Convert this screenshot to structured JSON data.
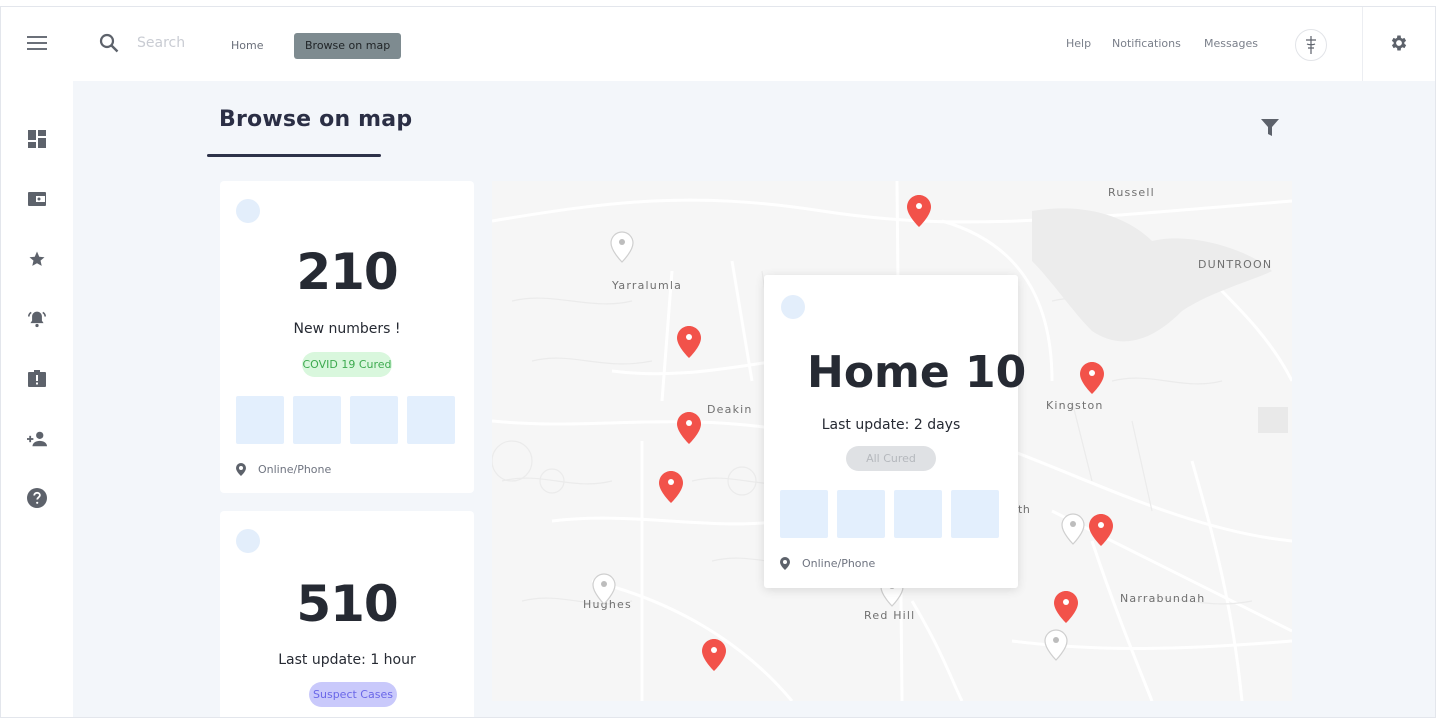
{
  "search": {
    "placeholder": "Search"
  },
  "nav": {
    "home": "Home",
    "browse_on_map": "Browse on map"
  },
  "header_links": {
    "help": "Help",
    "notifications": "Notifications",
    "messages": "Messages"
  },
  "page": {
    "title": "Browse on map"
  },
  "cards": [
    {
      "number": "210",
      "subtitle": "New numbers !",
      "badge": "COVID 19 Cured",
      "badge_color": "#d9f7dd",
      "badge_text_color": "#3daa4f",
      "location": "Online/Phone"
    },
    {
      "number": "510",
      "subtitle": "Last update: 1 hour",
      "badge": "Suspect Cases",
      "badge_color": "#c9c9fb",
      "badge_text_color": "#6a67e8"
    }
  ],
  "popup": {
    "title": "Home 10",
    "subtitle": "Last update: 2 days",
    "badge": "All Cured",
    "location": "Online/Phone"
  },
  "map": {
    "labels": {
      "russell": "Russell",
      "duntroon": "DUNTROON",
      "yarralumla": "Yarralumla",
      "deakin": "Deakin",
      "kingston": "Kingston",
      "hughes": "Hughes",
      "red_hill": "Red Hill",
      "narrabundah": "Narrabundah",
      "th": "th"
    }
  },
  "colors": {
    "pin_active": "#f2524a",
    "pin_inactive": "#ffffff",
    "accent_dark": "#2d3249",
    "tile": "#e3effd"
  },
  "icons": [
    "menu-icon",
    "search-icon",
    "dashboard-icon",
    "wallet-icon",
    "star-icon",
    "alarm-icon",
    "report-icon",
    "add-user-icon",
    "help-icon",
    "settings-icon",
    "filter-icon",
    "location-pin-icon",
    "avatar-logo"
  ]
}
